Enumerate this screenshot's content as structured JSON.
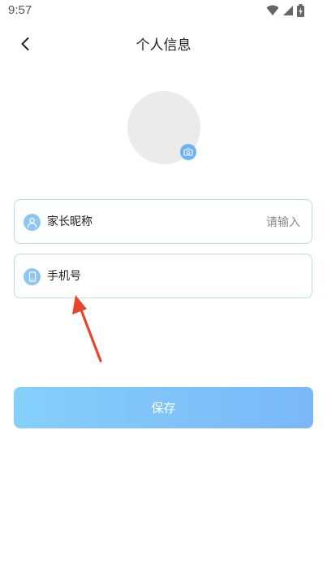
{
  "status_bar": {
    "time": "9:57",
    "icons": [
      "wifi-icon",
      "cell-signal-icon",
      "battery-charging-icon"
    ]
  },
  "header": {
    "back_icon": "chevron-left-icon",
    "title": "个人信息"
  },
  "avatar": {
    "badge_icon": "camera-icon",
    "badge_color": "#6cb4f0",
    "placeholder_color": "#ebebeb"
  },
  "form": {
    "nickname": {
      "icon": "user-icon",
      "label": "家长昵称",
      "value": "",
      "placeholder": "请输入"
    },
    "phone": {
      "icon": "mobile-phone-icon",
      "label": "手机号",
      "value": "",
      "placeholder": ""
    }
  },
  "save_button": {
    "label": "保存",
    "gradient": [
      "#85d0fb",
      "#7ab7f8"
    ]
  },
  "annotation": {
    "icon": "red-arrow-icon",
    "color": "#e8452f"
  },
  "colors": {
    "field_border": "#b9dcf2",
    "field_icon_bg": "#8ec6f2"
  }
}
